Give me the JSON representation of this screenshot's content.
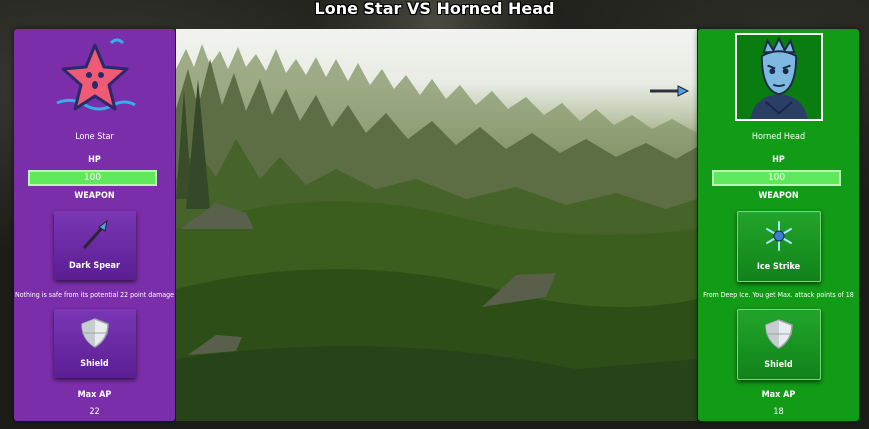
{
  "title": "Lone Star VS Horned Head",
  "colors": {
    "left_panel": "#7a2ea9",
    "right_panel": "#119b17",
    "hp_bar": "#5fe85c"
  },
  "left": {
    "name": "Lone Star",
    "avatar_icon": "star-character-icon",
    "hp_label": "HP",
    "hp_value": "100",
    "weapon_label": "WEAPON",
    "weapon_name": "Dark Spear",
    "weapon_icon": "spear-icon",
    "weapon_desc": "Nothing is safe from its potential 22 point damage",
    "shield_name": "Shield",
    "shield_icon": "shield-icon",
    "max_ap_label": "Max AP",
    "max_ap_value": "22"
  },
  "right": {
    "name": "Horned Head",
    "avatar_icon": "horned-head-character-icon",
    "hp_label": "HP",
    "hp_value": "100",
    "weapon_label": "WEAPON",
    "weapon_name": "Ice Strike",
    "weapon_icon": "snowflake-icon",
    "weapon_desc": "From Deep Ice. You get Max. attack points of 18",
    "shield_name": "Shield",
    "shield_icon": "shield-icon",
    "max_ap_label": "Max AP",
    "max_ap_value": "18"
  },
  "scene": {
    "projectile_icon": "spear-projectile-icon"
  }
}
